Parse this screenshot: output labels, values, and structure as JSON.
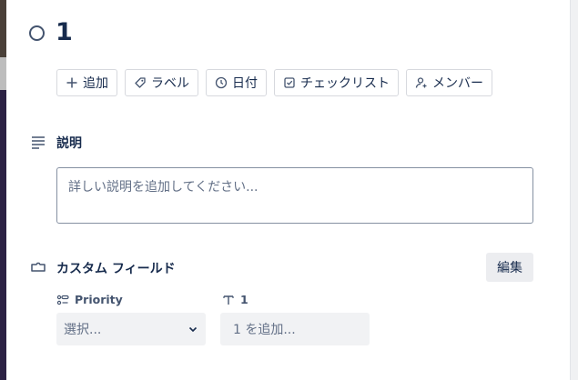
{
  "card": {
    "title": "1"
  },
  "actions": [
    {
      "label": "追加",
      "icon": "plus-icon"
    },
    {
      "label": "ラベル",
      "icon": "tag-icon"
    },
    {
      "label": "日付",
      "icon": "clock-icon"
    },
    {
      "label": "チェックリスト",
      "icon": "checkbox-icon"
    },
    {
      "label": "メンバー",
      "icon": "add-user-icon"
    }
  ],
  "description": {
    "heading": "説明",
    "icon": "lines-icon",
    "placeholder": "詳しい説明を追加してください..."
  },
  "custom_fields": {
    "heading": "カスタム フィールド",
    "icon": "field-icon",
    "edit_label": "編集",
    "fields": [
      {
        "label": "Priority",
        "icon": "dropdown-field-icon",
        "value_placeholder": "選択..."
      },
      {
        "label": "1",
        "icon": "text-field-icon",
        "value_placeholder": "1 を追加..."
      }
    ]
  }
}
